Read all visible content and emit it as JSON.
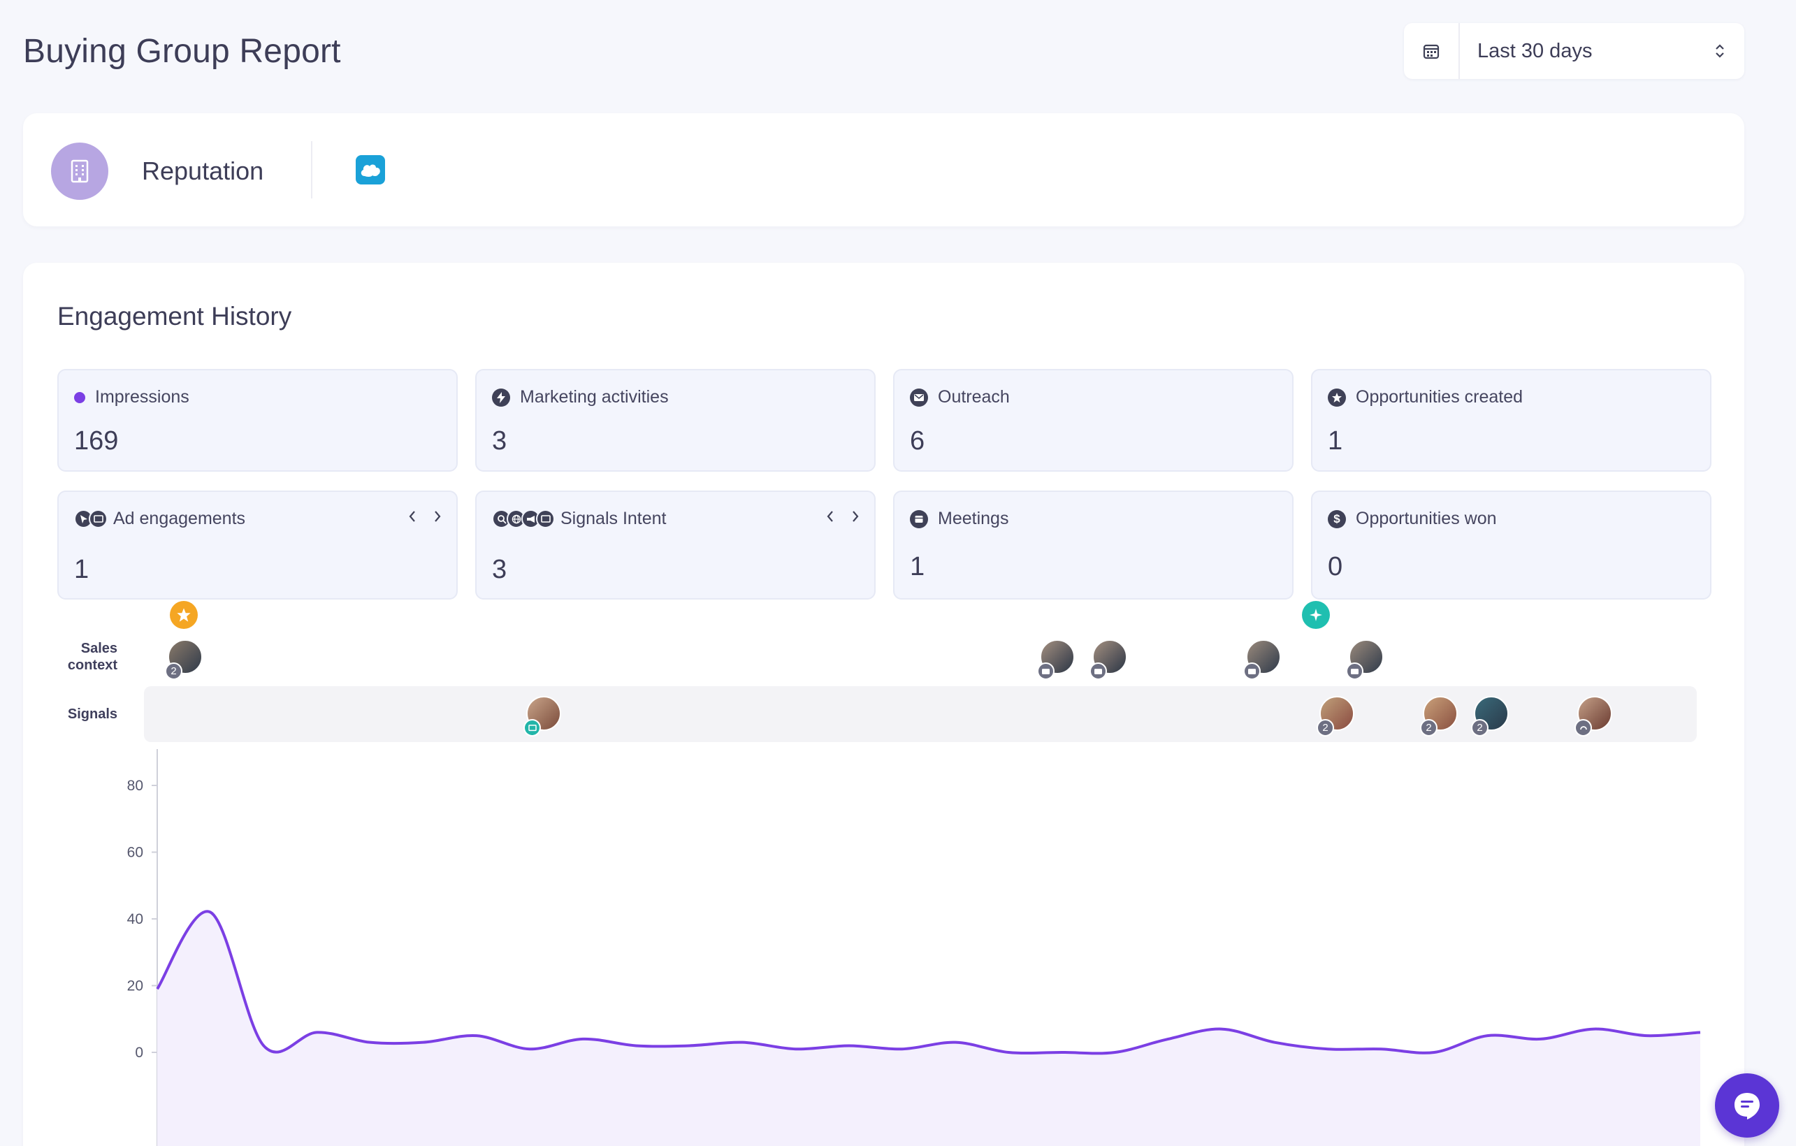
{
  "header": {
    "title": "Buying Group Report",
    "date_range": {
      "value": "Last 30 days",
      "icon": "calendar-icon",
      "caret_icon": "chevron-updown-icon"
    }
  },
  "company": {
    "name": "Reputation",
    "avatar_icon": "building-icon",
    "crm_icon": "salesforce-icon"
  },
  "engagement": {
    "title": "Engagement History",
    "metrics": [
      {
        "label": "Impressions",
        "value": "169",
        "icon": "dot-icon"
      },
      {
        "label": "Marketing activities",
        "value": "3",
        "icon": "bolt-icon"
      },
      {
        "label": "Outreach",
        "value": "6",
        "icon": "mail-icon"
      },
      {
        "label": "Opportunities created",
        "value": "1",
        "icon": "star-icon"
      },
      {
        "label": "Ad engagements",
        "value": "1",
        "icon": "ad-icons"
      },
      {
        "label": "Signals Intent",
        "value": "3",
        "icon": "intent-icons"
      },
      {
        "label": "Meetings",
        "value": "1",
        "icon": "calendar-icon"
      },
      {
        "label": "Opportunities won",
        "value": "0",
        "icon": "dollar-icon"
      }
    ],
    "timeline": {
      "sales_context_label": "Sales\ncontext",
      "signals_label": "Signals",
      "badge_counts": [
        "2",
        "2",
        "2",
        "2"
      ]
    }
  },
  "colors": {
    "accent": "#7b3fe4",
    "marker_orange": "#f5a623",
    "marker_teal": "#1fbfb0",
    "crm_blue": "#1aa1d8"
  },
  "chart_data": {
    "type": "area",
    "yticks": [
      "80",
      "60",
      "40",
      "20",
      "0"
    ],
    "ylim": [
      0,
      90
    ],
    "x": [
      0,
      1,
      2,
      3,
      4,
      5,
      6,
      7,
      8,
      9,
      10,
      11,
      12,
      13,
      14,
      15,
      16,
      17,
      18,
      19,
      20,
      21,
      22,
      23,
      24,
      25,
      26,
      27,
      28,
      29
    ],
    "series": [
      {
        "values": [
          19,
          42,
          2,
          6,
          3,
          3,
          5,
          1,
          4,
          2,
          2,
          3,
          1,
          2,
          1,
          3,
          0,
          0,
          0,
          4,
          7,
          3,
          1,
          1,
          0,
          5,
          4,
          7,
          5,
          6
        ]
      }
    ],
    "grid": false
  }
}
